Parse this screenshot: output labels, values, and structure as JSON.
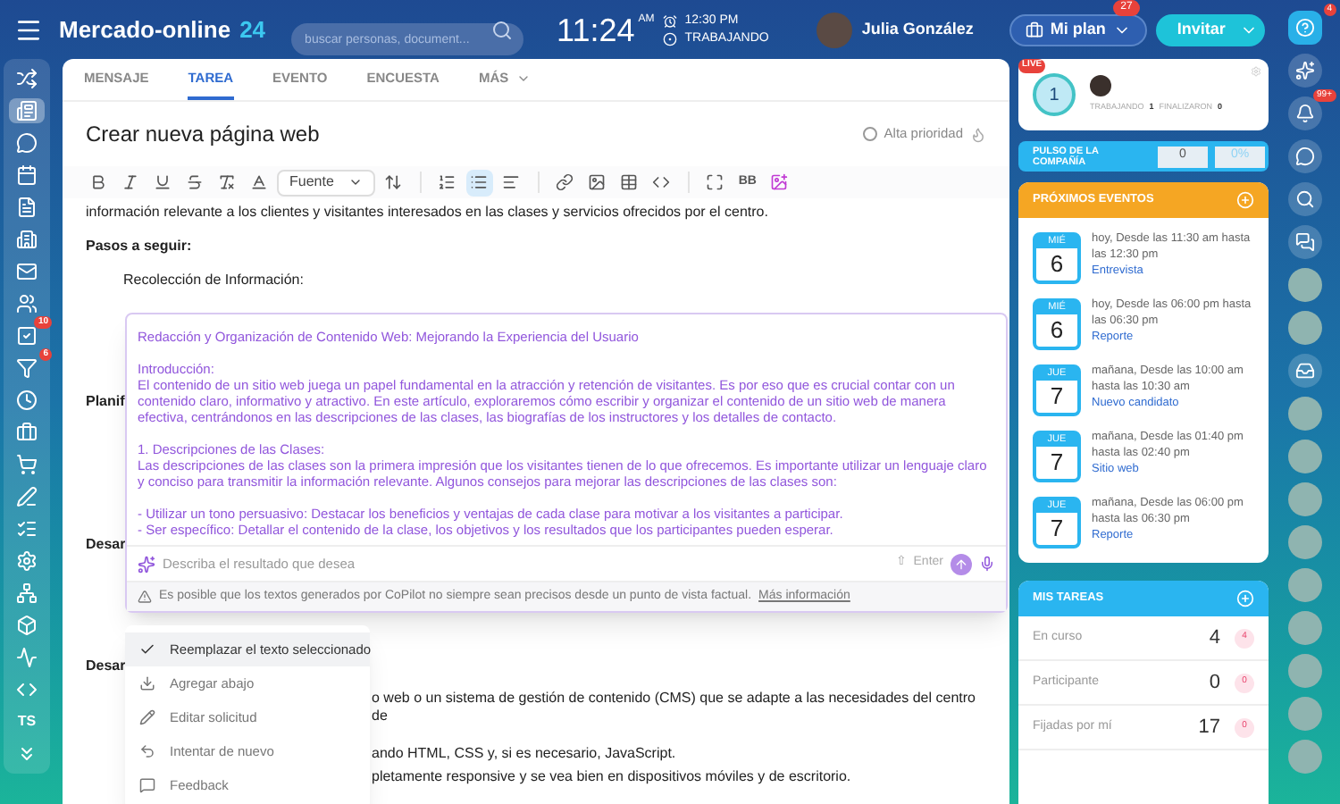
{
  "topbar": {
    "brand": "Mercado-online",
    "brand_number": "24",
    "search": {
      "placeholder": "buscar personas, document..."
    },
    "clock": "11:24",
    "meridiem": "AM",
    "alarm": "12:30 PM",
    "status": "TRABAJANDO",
    "user": "Julia González",
    "plan_button": "Mi plan",
    "plan_badge": "27",
    "invite_button": "Invitar"
  },
  "left_nav": [
    {
      "kind": "shuffle",
      "selected": false
    },
    {
      "kind": "feed",
      "selected": true
    },
    {
      "kind": "chat",
      "selected": false
    },
    {
      "kind": "calendar",
      "selected": false
    },
    {
      "kind": "file",
      "selected": false
    },
    {
      "kind": "building",
      "selected": false
    },
    {
      "kind": "mail",
      "selected": false
    },
    {
      "kind": "users",
      "selected": false
    },
    {
      "kind": "tasks",
      "selected": false,
      "badge": "10"
    },
    {
      "kind": "filter",
      "selected": false,
      "badge": "6"
    },
    {
      "kind": "clock",
      "selected": false
    },
    {
      "kind": "briefcase",
      "selected": false
    },
    {
      "kind": "cart",
      "selected": false
    },
    {
      "kind": "pen",
      "selected": false
    },
    {
      "kind": "list",
      "selected": false
    },
    {
      "kind": "gear",
      "selected": false
    },
    {
      "kind": "network",
      "selected": false
    },
    {
      "kind": "box",
      "selected": false
    },
    {
      "kind": "zigzag",
      "selected": false
    },
    {
      "kind": "code",
      "selected": false
    },
    {
      "kind": "text",
      "label": "TS",
      "selected": false
    },
    {
      "kind": "more",
      "selected": false
    }
  ],
  "tabs": [
    {
      "label": "MENSAJE",
      "selected": false
    },
    {
      "label": "TAREA",
      "selected": true
    },
    {
      "label": "EVENTO",
      "selected": false
    },
    {
      "label": "ENCUESTA",
      "selected": false
    },
    {
      "label": "MÁS",
      "selected": false,
      "dropdown": true
    }
  ],
  "task": {
    "title": "Crear nueva página web",
    "high_priority": {
      "label": "Alta prioridad",
      "checked": false
    }
  },
  "toolbar": [
    {
      "kind": "bold",
      "active": false
    },
    {
      "kind": "italic",
      "active": false
    },
    {
      "kind": "underline",
      "active": false
    },
    {
      "kind": "strike",
      "active": false
    },
    {
      "kind": "clear",
      "active": false
    },
    {
      "kind": "color",
      "active": false
    },
    {
      "kind": "font",
      "label": "Fuente"
    },
    {
      "kind": "size",
      "active": false
    },
    {
      "kind": "sep"
    },
    {
      "kind": "ordered",
      "active": false
    },
    {
      "kind": "bullets",
      "active": true
    },
    {
      "kind": "align",
      "active": false
    },
    {
      "kind": "sep"
    },
    {
      "kind": "link",
      "active": false
    },
    {
      "kind": "image",
      "active": false
    },
    {
      "kind": "table",
      "active": false
    },
    {
      "kind": "code",
      "active": false
    },
    {
      "kind": "sep"
    },
    {
      "kind": "fullscreen",
      "active": false
    },
    {
      "kind": "bbcode",
      "label": "BB"
    },
    {
      "kind": "copilot",
      "active": false
    }
  ],
  "body": {
    "intro_line": "información relevante a los clientes y visitantes interesados en las clases y servicios ofrecidos por el centro.",
    "steps_heading": "Pasos a seguir:",
    "step_1": "Recolección de Información:",
    "heading_2": "Planif",
    "heading_3": "Desar",
    "heading_4": "Desar",
    "lines_after": [
      "o web o un sistema de gestión de contenido (CMS) que se adapte a las necesidades del centro de",
      "ando HTML, CSS y, si es necesario, JavaScript.",
      "pletamente responsive y se vea bien en dispositivos móviles y de escritorio."
    ]
  },
  "copilot": {
    "blocks": [
      [
        "Redacción y Organización de Contenido Web: Mejorando la Experiencia del Usuario"
      ],
      [
        "Introducción:",
        "El contenido de un sitio web juega un papel fundamental en la atracción y retención de visitantes. Es por eso que es crucial contar con un contenido claro, informativo y atractivo. En este artículo, exploraremos cómo escribir y organizar el contenido de un sitio web de manera efectiva, centrándonos en las descripciones de las clases, las biografías de los instructores y los detalles de contacto."
      ],
      [
        "1. Descripciones de las Clases:",
        "Las descripciones de las clases son la primera impresión que los visitantes tienen de lo que ofrecemos. Es importante utilizar un lenguaje claro y conciso para transmitir la información relevante. Algunos consejos para mejorar las descripciones de las clases son:"
      ],
      [
        "- Utilizar un tono persuasivo: Destacar los beneficios y ventajas de cada clase para motivar a los visitantes a participar.",
        "- Ser específico: Detallar el contenido de la clase, los objetivos y los resultados que los participantes pueden esperar."
      ]
    ],
    "prompt": {
      "placeholder": "Describa el resultado que desea"
    },
    "shift_symbol": "⇧",
    "send_hint": "Enter",
    "disclaimer": "Es posible que los textos generados por CoPilot no siempre sean precisos desde un punto de vista factual.",
    "more_link": "Más información"
  },
  "menu": [
    {
      "kind": "check",
      "label": "Reemplazar el texto seleccionado",
      "selected": true
    },
    {
      "kind": "download",
      "label": "Agregar abajo",
      "selected": false
    },
    {
      "kind": "pencil",
      "label": "Editar solicitud",
      "selected": false
    },
    {
      "kind": "undo",
      "label": "Intentar de nuevo",
      "selected": false
    },
    {
      "kind": "feedback",
      "label": "Feedback",
      "selected": false
    }
  ],
  "live_card": {
    "tag": "LIVE",
    "count": "1",
    "working_label": "TRABAJANDO",
    "working": "1",
    "finished_label": "FINALIZARON",
    "finished": "0"
  },
  "pulse": {
    "label": "PULSO DE LA COMPAÑÍA",
    "value": "0",
    "percent": "0%"
  },
  "events": {
    "title": "PRÓXIMOS EVENTOS",
    "items": [
      {
        "weekday": "MIÉ",
        "day": "6",
        "text": "hoy, Desde las 11:30 am hasta las 12:30 pm",
        "link": "Entrevista"
      },
      {
        "weekday": "MIÉ",
        "day": "6",
        "text": "hoy, Desde las 06:00 pm hasta las 06:30 pm",
        "link": "Reporte"
      },
      {
        "weekday": "JUE",
        "day": "7",
        "text": "mañana, Desde las 10:00 am hasta las 10:30 am",
        "link": "Nuevo candidato"
      },
      {
        "weekday": "JUE",
        "day": "7",
        "text": "mañana, Desde las 01:40 pm hasta las 02:40 pm",
        "link": "Sitio web"
      },
      {
        "weekday": "JUE",
        "day": "7",
        "text": "mañana, Desde las 06:00 pm hasta las 06:30 pm",
        "link": "Reporte"
      }
    ]
  },
  "my_tasks": {
    "title": "MIS TAREAS",
    "rows": [
      {
        "label": "En curso",
        "count": "4",
        "badge": "4"
      },
      {
        "label": "Participante",
        "count": "0",
        "badge": "0"
      },
      {
        "label": "Fijadas por mí",
        "count": "17",
        "badge": "0"
      }
    ]
  },
  "right_strip": [
    {
      "kind": "help",
      "badge": "4"
    },
    {
      "kind": "copilot"
    },
    {
      "kind": "bell",
      "badge": "99+"
    },
    {
      "kind": "chat"
    },
    {
      "kind": "search"
    },
    {
      "kind": "messages"
    },
    {
      "kind": "avatar"
    },
    {
      "kind": "avatar"
    },
    {
      "kind": "inbox"
    },
    {
      "kind": "avatar"
    },
    {
      "kind": "avatar"
    },
    {
      "kind": "avatar"
    },
    {
      "kind": "avatar"
    },
    {
      "kind": "avatar"
    },
    {
      "kind": "avatar"
    },
    {
      "kind": "avatar"
    },
    {
      "kind": "avatar"
    },
    {
      "kind": "avatar"
    }
  ]
}
